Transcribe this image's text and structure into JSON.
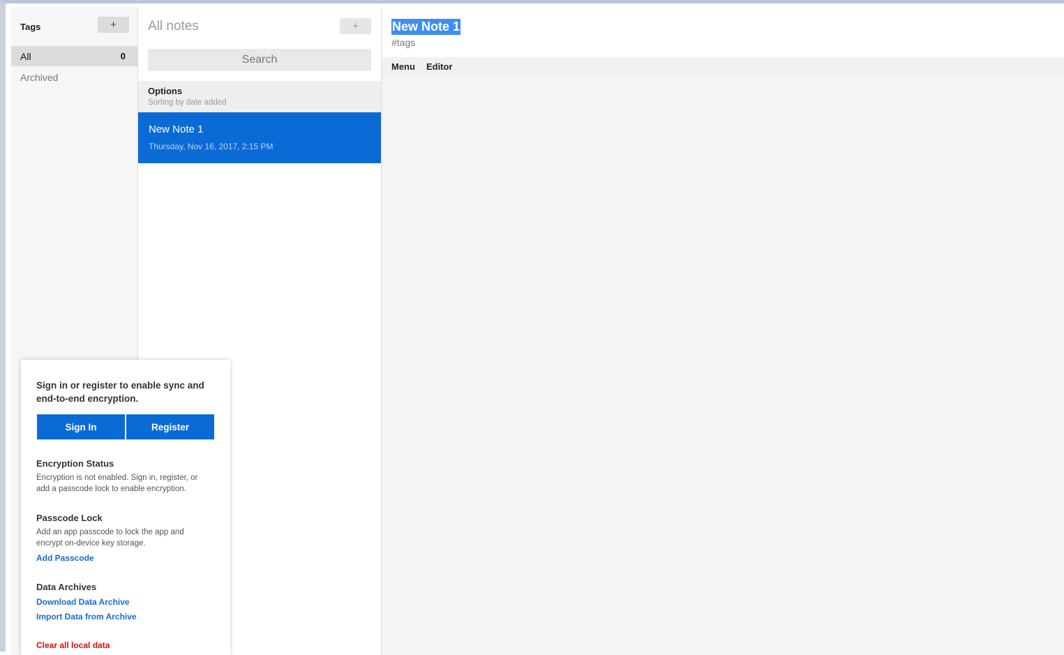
{
  "tags_panel": {
    "title": "Tags",
    "add_label": "+",
    "items": [
      {
        "label": "All",
        "count": "0"
      },
      {
        "label": "Archived"
      }
    ]
  },
  "notes_panel": {
    "title": "All notes",
    "add_label": "+",
    "search_placeholder": "Search",
    "options": {
      "title": "Options",
      "subtitle": "Sorting by date added"
    },
    "notes": [
      {
        "title": "New Note 1",
        "date": "Thursday, Nov 16, 2017, 2:15 PM"
      }
    ]
  },
  "editor": {
    "title": "New Note 1",
    "tags": "#tags",
    "toolbar": [
      "Menu",
      "Editor"
    ]
  },
  "account_panel": {
    "headline": "Sign in or register to enable sync and end-to-end encryption.",
    "sign_in_label": "Sign In",
    "register_label": "Register",
    "encryption": {
      "title": "Encryption Status",
      "text": "Encryption is not enabled. Sign in, register, or add a passcode lock to enable encryption."
    },
    "passcode": {
      "title": "Passcode Lock",
      "text": "Add an app passcode to lock the app and encrypt on-device key storage.",
      "link": "Add Passcode"
    },
    "archives": {
      "title": "Data Archives",
      "download_link": "Download Data Archive",
      "import_link": "Import Data from Archive"
    },
    "clear_label": "Clear all local data"
  },
  "colors": {
    "accent": "#0b6bd6",
    "selection": "#3d8ef2",
    "danger": "#d40f0f",
    "link": "#1a6ad0"
  }
}
